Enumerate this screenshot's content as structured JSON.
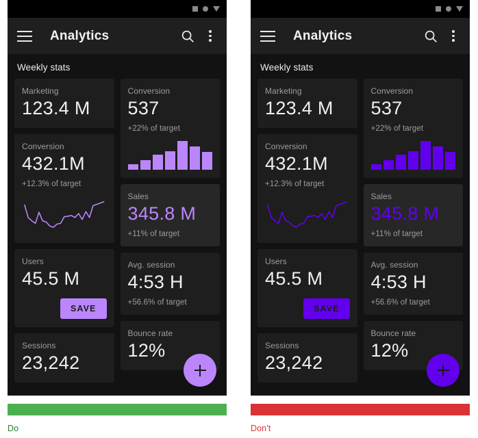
{
  "colors": {
    "do_rule": "#4caf50",
    "dont_rule": "#db3236",
    "do_caption_text": "#2e7d32",
    "dont_caption_text": "#db3236",
    "accent_do": "#bb86fc",
    "accent_dont": "#6200ee",
    "surface": "#1e1e1e",
    "surface_elevated": "#272727",
    "background": "#121212",
    "appbar": "#1f1f1f"
  },
  "statusbar": {
    "icons": [
      "square-icon",
      "circle-icon",
      "triangle-down-icon"
    ]
  },
  "appbar": {
    "menu_icon": "hamburger-menu-icon",
    "title": "Analytics",
    "search_icon": "search-icon",
    "overflow_icon": "overflow-menu-icon"
  },
  "section": {
    "title": "Weekly stats"
  },
  "cards": {
    "marketing": {
      "label": "Marketing",
      "value": "123.4 M"
    },
    "conversion_537": {
      "label": "Conversion",
      "value": "537",
      "sub": "+22% of target"
    },
    "conversion_432": {
      "label": "Conversion",
      "value": "432.1M",
      "sub": "+12.3% of target"
    },
    "sales": {
      "label": "Sales",
      "value": "345.8 M",
      "sub": "+11% of target"
    },
    "users": {
      "label": "Users",
      "value": "45.5 M",
      "button": "SAVE"
    },
    "avg_session": {
      "label": "Avg. session",
      "value": "4:53 H",
      "sub": "+56.6% of target"
    },
    "sessions": {
      "label": "Sessions",
      "value": "23,242"
    },
    "bounce_rate": {
      "label": "Bounce rate",
      "value": "12%"
    }
  },
  "fab": {
    "icon": "plus-icon"
  },
  "chart_data": [
    {
      "type": "bar",
      "title": "Conversion weekly bars",
      "categories": [
        "1",
        "2",
        "3",
        "4",
        "5",
        "6",
        "7"
      ],
      "values": [
        18,
        34,
        52,
        65,
        100,
        80,
        62
      ],
      "xlabel": "",
      "ylabel": "",
      "ylim": [
        0,
        100
      ],
      "grid": false,
      "legend": "none"
    },
    {
      "type": "line",
      "title": "Conversion trend sparkline",
      "x": [
        0,
        1,
        2,
        3,
        4,
        5,
        6,
        7,
        8,
        9,
        10,
        11,
        12,
        13,
        14,
        15,
        16,
        17,
        18,
        19,
        20,
        21,
        22
      ],
      "y": [
        78,
        40,
        30,
        22,
        56,
        30,
        26,
        14,
        10,
        20,
        22,
        42,
        44,
        46,
        40,
        52,
        34,
        58,
        40,
        76,
        80,
        84,
        88
      ],
      "xlabel": "",
      "ylabel": "",
      "ylim": [
        0,
        100
      ],
      "grid": false,
      "legend": "none"
    }
  ],
  "footer": {
    "do": {
      "caption": "Do"
    },
    "dont": {
      "caption": "Don't"
    }
  }
}
